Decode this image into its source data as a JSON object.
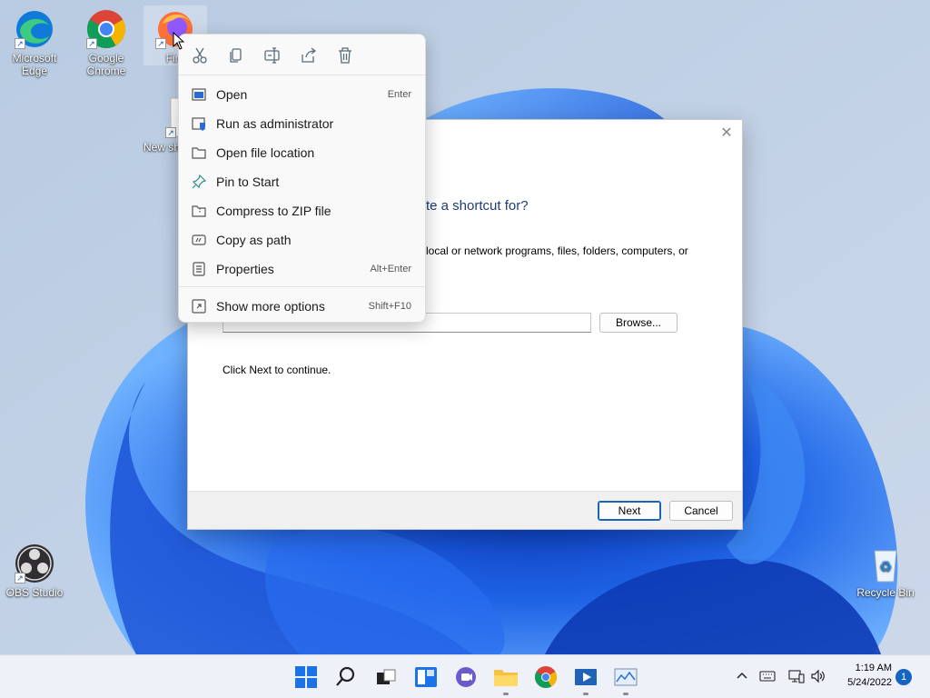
{
  "desktop": {
    "icons": [
      {
        "label_line1": "Microsoft",
        "label_line2": "Edge"
      },
      {
        "label_line1": "Google",
        "label_line2": "Chrome"
      },
      {
        "label_line1": "Fire"
      },
      {
        "label_line1": "New sh"
      },
      {
        "label_line1": "OBS Studio"
      },
      {
        "label_line1": "Recycle Bin"
      }
    ]
  },
  "dialog": {
    "close_glyph": "✕",
    "question": "te a shortcut for?",
    "description": "local or network programs, files, folders, computers, or",
    "location_value": "",
    "browse_label": "Browse...",
    "continue_text": "Click Next to continue.",
    "next_label": "Next",
    "cancel_label": "Cancel"
  },
  "context_menu": {
    "toolbar": [
      "cut-icon",
      "copy-icon",
      "rename-icon",
      "share-icon",
      "delete-icon"
    ],
    "items": [
      {
        "label": "Open",
        "shortcut": "Enter",
        "icon": "open-icon"
      },
      {
        "label": "Run as administrator",
        "shortcut": "",
        "icon": "shield-icon"
      },
      {
        "label": "Open file location",
        "shortcut": "",
        "icon": "folder-icon"
      },
      {
        "label": "Pin to Start",
        "shortcut": "",
        "icon": "pin-icon"
      },
      {
        "label": "Compress to ZIP file",
        "shortcut": "",
        "icon": "zip-icon"
      },
      {
        "label": "Copy as path",
        "shortcut": "",
        "icon": "path-icon"
      },
      {
        "label": "Properties",
        "shortcut": "Alt+Enter",
        "icon": "properties-icon"
      },
      {
        "label": "Show more options",
        "shortcut": "Shift+F10",
        "icon": "more-options-icon"
      }
    ]
  },
  "taskbar": {
    "clock_time": "1:19 AM",
    "clock_date": "5/24/2022",
    "notification_count": "1"
  },
  "colors": {
    "accent": "#1a64b6",
    "question_text": "#1e3c78",
    "taskbar_bg": "#eef2f8",
    "menu_bg": "#f9f9f9"
  }
}
